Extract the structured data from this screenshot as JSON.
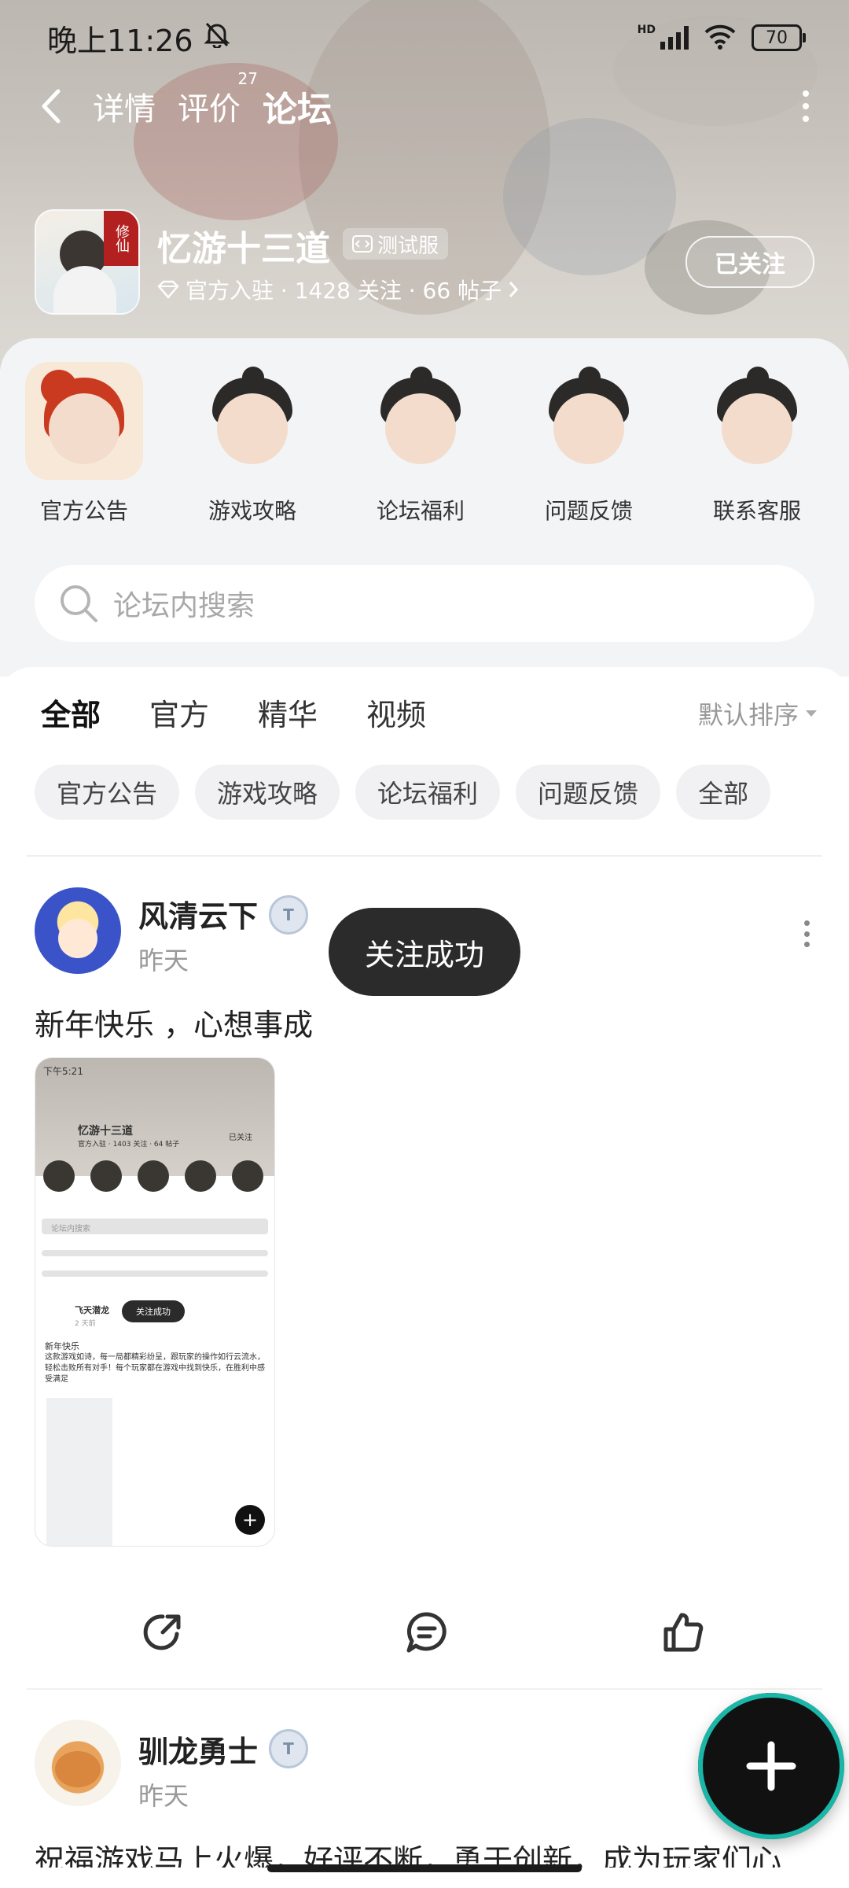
{
  "status_bar": {
    "time": "晚上11:26",
    "battery": "70",
    "network": "HD"
  },
  "nav": {
    "tabs": [
      {
        "label": "详情",
        "badge": ""
      },
      {
        "label": "评价",
        "badge": "27"
      },
      {
        "label": "论坛",
        "badge": ""
      }
    ]
  },
  "app": {
    "name": "忆游十三道",
    "tag": "测试服",
    "icon_tag": "修仙",
    "meta": "官方入驻 · 1428 关注 · 66 帖子",
    "follow_button": "已关注"
  },
  "categories": [
    {
      "label": "官方公告"
    },
    {
      "label": "游戏攻略"
    },
    {
      "label": "论坛福利"
    },
    {
      "label": "问题反馈"
    },
    {
      "label": "联系客服"
    }
  ],
  "search": {
    "placeholder": "论坛内搜索"
  },
  "filter_tabs": [
    {
      "label": "全部"
    },
    {
      "label": "官方"
    },
    {
      "label": "精华"
    },
    {
      "label": "视频"
    }
  ],
  "sort": {
    "label": "默认排序"
  },
  "chips": [
    {
      "label": "官方公告"
    },
    {
      "label": "游戏攻略"
    },
    {
      "label": "论坛福利"
    },
    {
      "label": "问题反馈"
    },
    {
      "label": "全部"
    }
  ],
  "toast": {
    "text": "关注成功"
  },
  "posts": [
    {
      "author": "风清云下",
      "time": "昨天",
      "text": "新年快乐 ，心想事成",
      "screenshot": {
        "time": "下午5:21",
        "app_name": "忆游十三道",
        "meta": "官方入驻 · 1403 关注 · 64 帖子",
        "follow": "已关注",
        "search": "论坛内搜索",
        "author": "飞天潜龙",
        "ago": "2 天前",
        "toast": "关注成功",
        "title": "新年快乐",
        "body": "这款游戏如诗，每一局都精彩纷呈，跟玩家的操作如行云流水，轻松击败所有对手！每个玩家都在游戏中找到快乐，在胜利中感受满足"
      }
    },
    {
      "author": "驯龙勇士",
      "time": "昨天",
      "text": "祝福游戏马上火爆，好评不断，勇于创新，成为玩家们心"
    }
  ],
  "colors": {
    "accent": "#2ec4b6",
    "toast_bg": "#2b2b2b"
  }
}
